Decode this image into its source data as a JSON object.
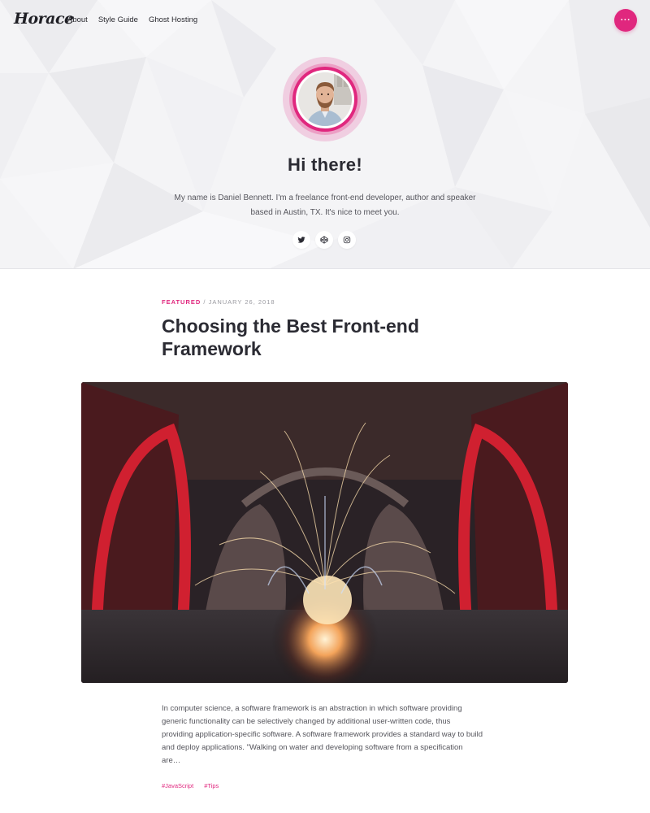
{
  "site": {
    "logo": "Horace",
    "nav": [
      "About",
      "Style Guide",
      "Ghost Hosting"
    ],
    "menu_button_label": "···",
    "accent_color": "#e0277e"
  },
  "hero": {
    "title": "Hi there!",
    "bio": "My name is Daniel Bennett. I'm a freelance front-end developer, author and speaker based in Austin, TX. It's nice to meet you.",
    "social_icons": [
      "twitter-icon",
      "codepen-icon",
      "instagram-icon"
    ]
  },
  "post": {
    "tag_label": "Featured",
    "date_separator": "/",
    "date": "January 26, 2018",
    "title": "Choosing the Best Front-end Framework",
    "excerpt": "In computer science, a software framework is an abstraction in which software providing generic functionality can be selectively changed by additional user-written code, thus providing application-specific software. A software framework provides a standard way to build and deploy applications. \"Walking on water and developing software from a specification are…",
    "tags": [
      "#JavaScript",
      "#Tips"
    ]
  }
}
